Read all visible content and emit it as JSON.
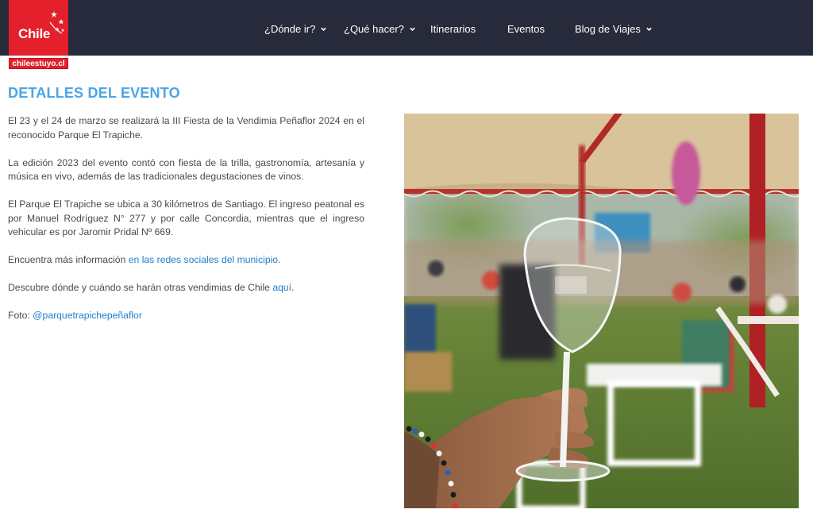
{
  "header": {
    "logo_text": "Chile",
    "logo_tagline": "chileestuyo.cl",
    "nav": [
      {
        "label": "¿Dónde ir?",
        "has_dropdown": true
      },
      {
        "label": "¿Qué hacer?",
        "has_dropdown": true
      },
      {
        "label": "Itinerarios",
        "has_dropdown": false
      },
      {
        "label": "Eventos",
        "has_dropdown": false
      },
      {
        "label": "Blog de Viajes",
        "has_dropdown": true
      }
    ]
  },
  "main": {
    "title": "DETALLES DEL EVENTO",
    "p1": "El 23 y el 24 de marzo se realizará la III Fiesta de la Vendimia Peñaflor 2024 en el reconocido Parque El Trapiche.",
    "p2": "La edición 2023 del evento contó con fiesta de la trilla, gastronomía, artesanía y música en vivo, además de las tradicionales degustaciones de vinos.",
    "p3": "El Parque El Trapiche se ubica a 30 kilómetros de Santiago. El ingreso peatonal es por Manuel Rodríguez N° 277 y por calle Concordia, mientras que el ingreso vehicular es por Jaromir Pridal Nº 669.",
    "p4_text": "Encuentra más información ",
    "p4_link": "en las redes sociales del municipio",
    "p4_end": ".",
    "p5_text": "Descubre dónde y cuándo se harán otras vendimias de Chile ",
    "p5_link": "aquí",
    "p5_end": ".",
    "photo_credit_label": "Foto: ",
    "photo_credit_link": "@parquetrapichepeñaflor"
  },
  "colors": {
    "topbar": "#262a3a",
    "brand_red": "#e3202c",
    "title_blue": "#4aa6e6",
    "link_blue": "#1e7fcf"
  },
  "icons": {
    "dropdown": "chevron-down-icon",
    "logo_mark": "star-icon"
  }
}
